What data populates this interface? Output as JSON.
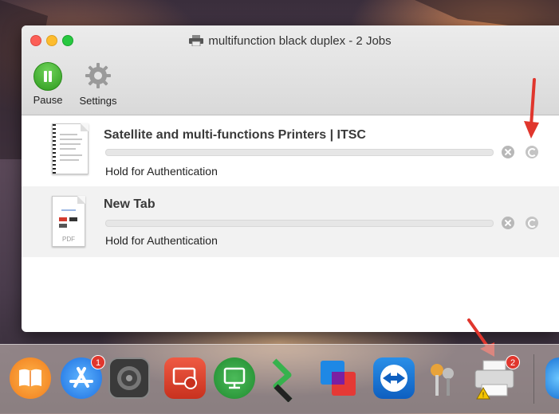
{
  "window": {
    "title": "multifunction black duplex - 2 Jobs"
  },
  "toolbar": {
    "pause_label": "Pause",
    "settings_label": "Settings"
  },
  "jobs": [
    {
      "title": "Satellite and multi-functions Printers | ITSC",
      "status": "Hold for Authentication",
      "progress": 0,
      "thumbnail": "webpage-document"
    },
    {
      "title": "New Tab",
      "status": "Hold for Authentication",
      "progress": 0,
      "thumbnail": "pdf-document",
      "thumb_label": "PDF"
    }
  ],
  "dock": {
    "items": [
      {
        "name": "ibooks",
        "icon": "book-icon"
      },
      {
        "name": "app-store",
        "icon": "app-store-icon",
        "badge": "1"
      },
      {
        "name": "system-preferences",
        "icon": "gear-icon"
      },
      {
        "name": "remote-desktop",
        "icon": "remote-desktop-icon"
      },
      {
        "name": "vmware-horizon",
        "icon": "monitor-icon"
      },
      {
        "name": "citrix",
        "icon": "s-logo-icon"
      },
      {
        "name": "vmware-fusion",
        "icon": "vmware-icon"
      },
      {
        "name": "teamviewer",
        "icon": "teamviewer-icon"
      },
      {
        "name": "keychain-access",
        "icon": "keys-icon"
      },
      {
        "name": "printer-queue",
        "icon": "printer-icon",
        "badge": "2"
      }
    ]
  },
  "colors": {
    "accent_red_arrow": "#e0362d",
    "pause_green": "#3aa82a"
  }
}
